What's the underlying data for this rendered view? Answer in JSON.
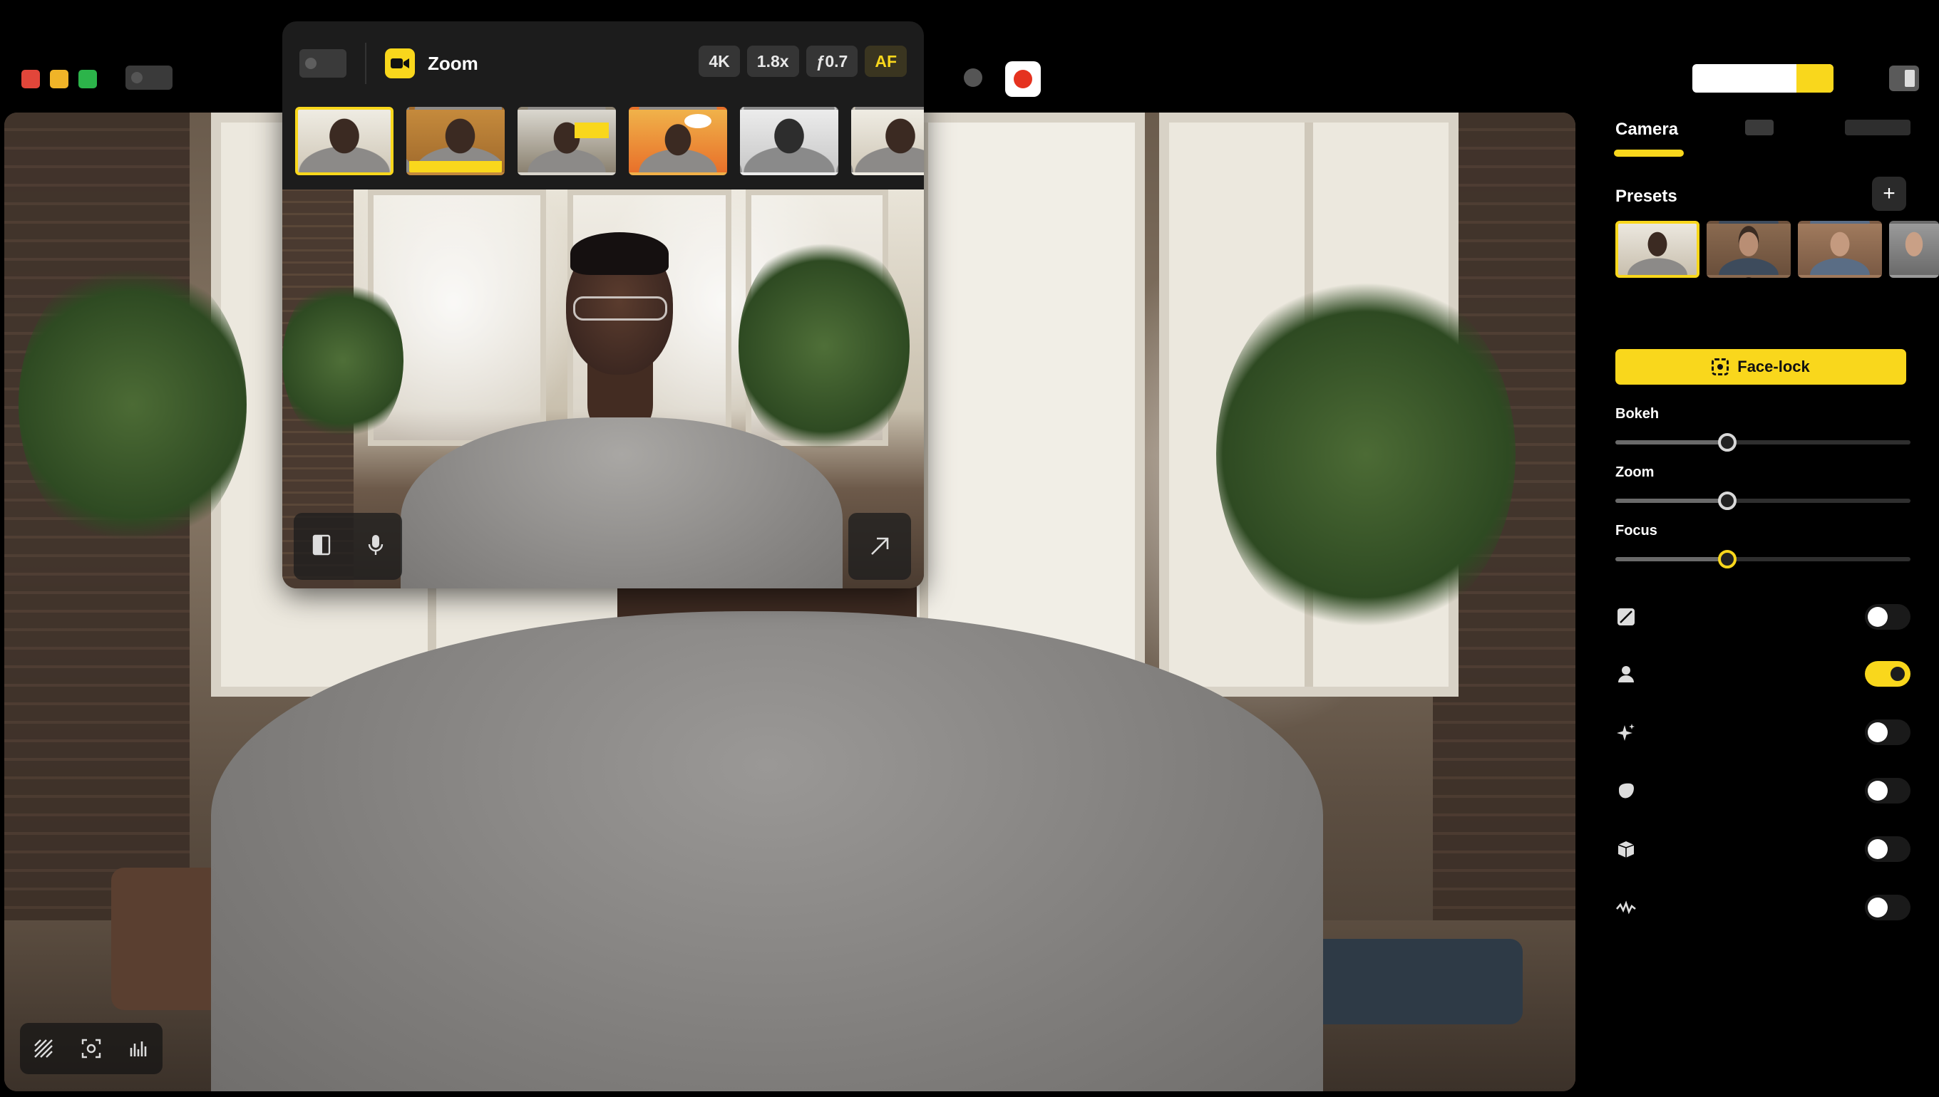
{
  "app": {
    "label": ""
  },
  "camera_panel": {
    "title": "Zoom",
    "chips": [
      "4K",
      "1.8x",
      "ƒ0.7",
      "AF"
    ]
  },
  "sidebar": {
    "tabs": [
      "Camera"
    ],
    "presets_title": "Presets",
    "presets": [
      {
        "label": "",
        "selected": true
      },
      {
        "label": "",
        "selected": false
      },
      {
        "label": "",
        "selected": false
      },
      {
        "label": "",
        "selected": false
      }
    ],
    "face_lock_label": "Face-lock",
    "sliders": [
      {
        "label": "Bokeh",
        "value": 0.38
      },
      {
        "label": "Zoom",
        "value": 0.38
      },
      {
        "label": "Focus",
        "value": 0.38
      }
    ],
    "toggles": [
      {
        "label": "",
        "icon": "slash-square-icon",
        "on": false
      },
      {
        "label": "",
        "icon": "user-icon",
        "on": true
      },
      {
        "label": "",
        "icon": "sparkle-icon",
        "on": false
      },
      {
        "label": "",
        "icon": "drop-icon",
        "on": false
      },
      {
        "label": "",
        "icon": "cube-icon",
        "on": false
      },
      {
        "label": "",
        "icon": "wave-icon",
        "on": false
      }
    ]
  },
  "colors": {
    "accent": "#F9D71C",
    "record": "#E5321F",
    "panel": "#1C1C1C"
  }
}
